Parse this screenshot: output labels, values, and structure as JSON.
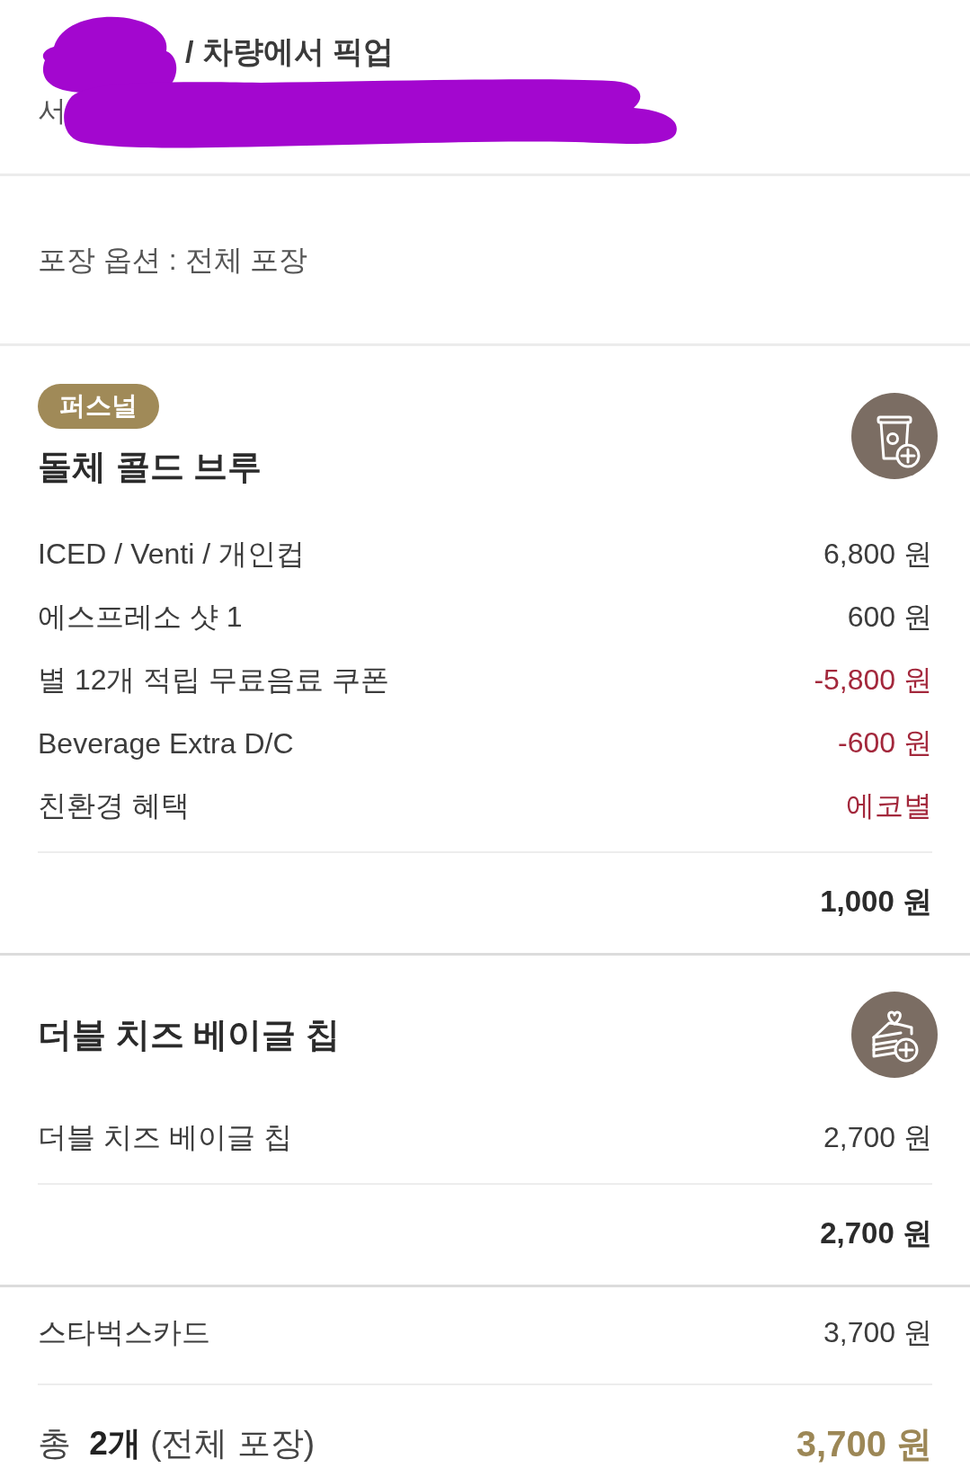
{
  "store": {
    "title": "/ 차량에서 픽업",
    "address": "서"
  },
  "packaging": "포장 옵션 : 전체 포장",
  "items": [
    {
      "kind": "drink",
      "badge": "퍼스널",
      "name": "돌체 콜드 브루",
      "lines": [
        {
          "label": "ICED / Venti / 개인컵",
          "amount": "6,800 원",
          "discount": false
        },
        {
          "label": "에스프레소 샷 1",
          "amount": "600 원",
          "discount": false
        },
        {
          "label": "별 12개 적립 무료음료 쿠폰",
          "amount": "-5,800 원",
          "discount": true
        },
        {
          "label": "Beverage Extra D/C",
          "amount": "-600 원",
          "discount": true
        },
        {
          "label": "친환경 혜택",
          "amount": "에코별",
          "discount": true
        }
      ],
      "subtotal": "1,000 원"
    },
    {
      "kind": "food",
      "name": "더블 치즈 베이글 칩",
      "lines": [
        {
          "label": "더블 치즈 베이글 칩",
          "amount": "2,700 원",
          "discount": false
        }
      ],
      "subtotal": "2,700 원"
    }
  ],
  "payment": {
    "method": "스타벅스카드",
    "amount": "3,700 원"
  },
  "total": {
    "label": "총 **2개** (전체 포장)",
    "amount": "3,700 원"
  }
}
